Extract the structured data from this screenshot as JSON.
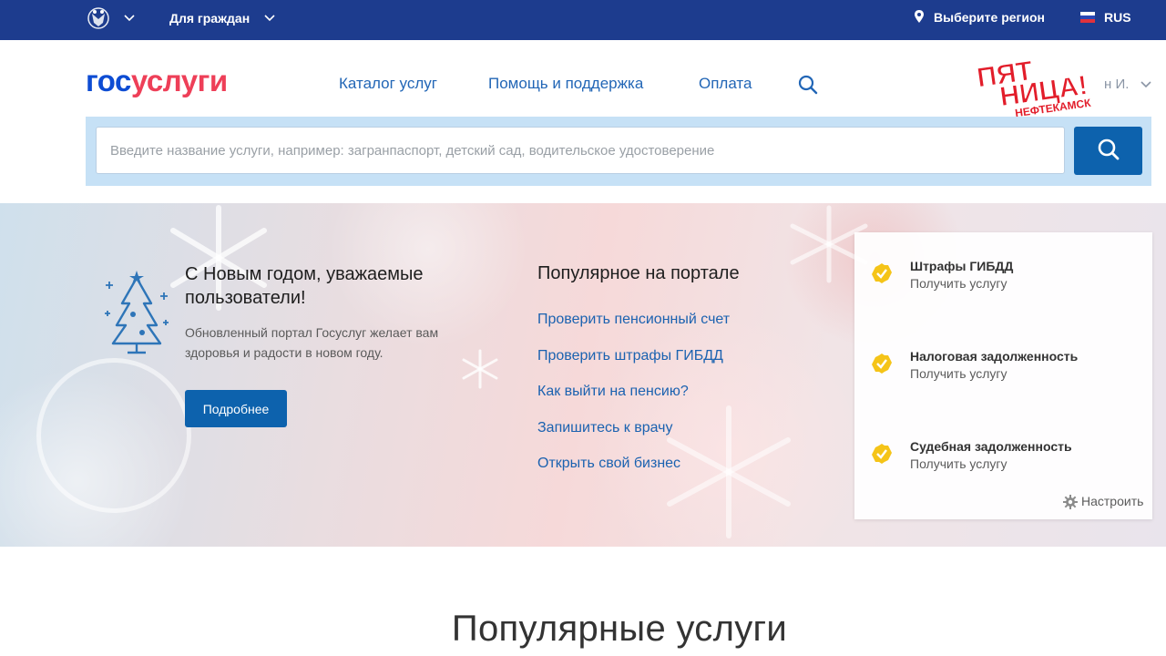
{
  "topbar": {
    "citizens_label": "Для граждан",
    "region_label": "Выберите регион",
    "language_label": "RUS"
  },
  "header": {
    "logo_part1": "гос",
    "logo_part2": "услуги",
    "nav": [
      "Каталог услуг",
      "Помощь и поддержка",
      "Оплата"
    ],
    "user_name_tail": "н И.",
    "overlay_logo": {
      "line1": "ПЯТ",
      "line2": "НИЦА!",
      "city": "НЕФТЕКАМСК"
    }
  },
  "search": {
    "placeholder": "Введите название услуги, например: загранпаспорт, детский сад, водительское удостоверение"
  },
  "banner": {
    "greeting_title": "С Новым годом, уважаемые пользователи!",
    "greeting_text": "Обновленный портал Госуслуг желает вам здоровья и радости в новом году.",
    "more_button": "Подробнее",
    "popular_title": "Популярное на портале",
    "popular_links": [
      "Проверить пенсионный счет",
      "Проверить штрафы ГИБДД",
      "Как выйти на пенсию?",
      "Запишитесь к врачу",
      "Открыть свой бизнес"
    ],
    "quick_services": [
      {
        "title": "Штрафы ГИБДД",
        "action": "Получить услугу"
      },
      {
        "title": "Налоговая задолженность",
        "action": "Получить услугу"
      },
      {
        "title": "Судебная задолженность",
        "action": "Получить услугу"
      }
    ],
    "configure_label": "Настроить"
  },
  "main": {
    "section_title": "Популярные услуги"
  },
  "colors": {
    "topbar": "#1d3c8e",
    "brand_blue": "#0d4cd3",
    "brand_red": "#ee3f58",
    "button_blue": "#0d62ad",
    "check_yellow": "#f5c418"
  },
  "icons": [
    "emblem-icon",
    "chevron-down-icon",
    "location-pin-icon",
    "russia-flag-icon",
    "search-icon",
    "christmas-tree-icon",
    "check-circle-icon",
    "gear-icon"
  ]
}
